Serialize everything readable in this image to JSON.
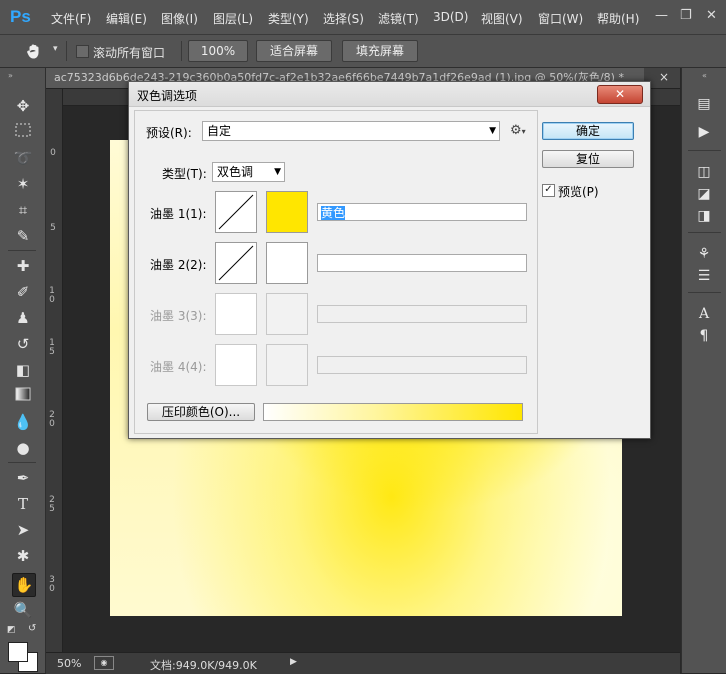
{
  "app": {
    "logo": "Ps",
    "menu": [
      "文件(F)",
      "编辑(E)",
      "图像(I)",
      "图层(L)",
      "类型(Y)",
      "选择(S)",
      "滤镜(T)",
      "3D(D)",
      "视图(V)",
      "窗口(W)",
      "帮助(H)"
    ],
    "window_controls": {
      "minimize": "—",
      "restore": "❐",
      "close": "✕"
    }
  },
  "options_bar": {
    "tool_icon": "hand-icon",
    "scroll_all_label": "滚动所有窗口",
    "scroll_all_checked": false,
    "zoom_100": "100%",
    "fit_screen": "适合屏幕",
    "fill_screen": "填充屏幕"
  },
  "document": {
    "tab_title": "ac75323d6b6de243-219c360b0a50fd7c-af2e1b32ae6f66be7449b7a1df26e9ad (1).jpg @ 50%(灰色/8) *",
    "tab_close": "×",
    "vruler_ticks": [
      "0",
      "5",
      "1 0",
      "1 5",
      "2 0",
      "2 5",
      "3 0"
    ]
  },
  "statusbar": {
    "zoom": "50%",
    "doc_info": "文档:949.0K/949.0K",
    "arrow": "▶"
  },
  "dialog": {
    "title": "双色调选项",
    "close": "✕",
    "preset_label": "预设(R):",
    "preset_value": "自定",
    "type_label": "类型(T):",
    "type_value": "双色调",
    "inks": [
      {
        "label": "油墨 1(1):",
        "color": "#ffe600",
        "name": "黄色",
        "enabled": true
      },
      {
        "label": "油墨 2(2):",
        "color": "#ffffff",
        "name": "",
        "enabled": true
      },
      {
        "label": "油墨 3(3):",
        "color": "",
        "name": "",
        "enabled": false
      },
      {
        "label": "油墨 4(4):",
        "color": "",
        "name": "",
        "enabled": false
      }
    ],
    "overprint_button": "压印颜色(O)...",
    "ok_button": "确定",
    "reset_button": "复位",
    "preview_label": "预览(P)",
    "preview_checked": true,
    "preview_check_mark": "✓"
  },
  "colors": {
    "ui_dark": "#535353",
    "ink_yellow": "#ffe600",
    "selection_blue": "#3399ff"
  }
}
